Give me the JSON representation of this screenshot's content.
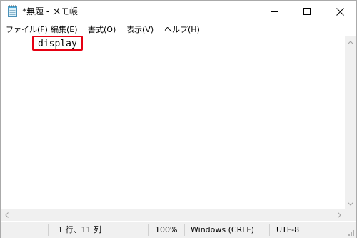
{
  "window": {
    "title": "*無題 - メモ帳"
  },
  "title_buttons": {
    "minimize_icon": "minimize-icon",
    "maximize_icon": "maximize-icon",
    "close_icon": "close-icon"
  },
  "menu": {
    "items": [
      {
        "label": "ファイル(F)"
      },
      {
        "label": "編集(E)"
      },
      {
        "label": "書式(O)"
      },
      {
        "label": "表示(V)"
      },
      {
        "label": "ヘルプ(H)"
      }
    ]
  },
  "editor": {
    "content": "display",
    "highlight_color": "#e60012"
  },
  "status": {
    "position": "1 行、11 列",
    "zoom": "100%",
    "line_ending": "Windows (CRLF)",
    "encoding": "UTF-8"
  }
}
